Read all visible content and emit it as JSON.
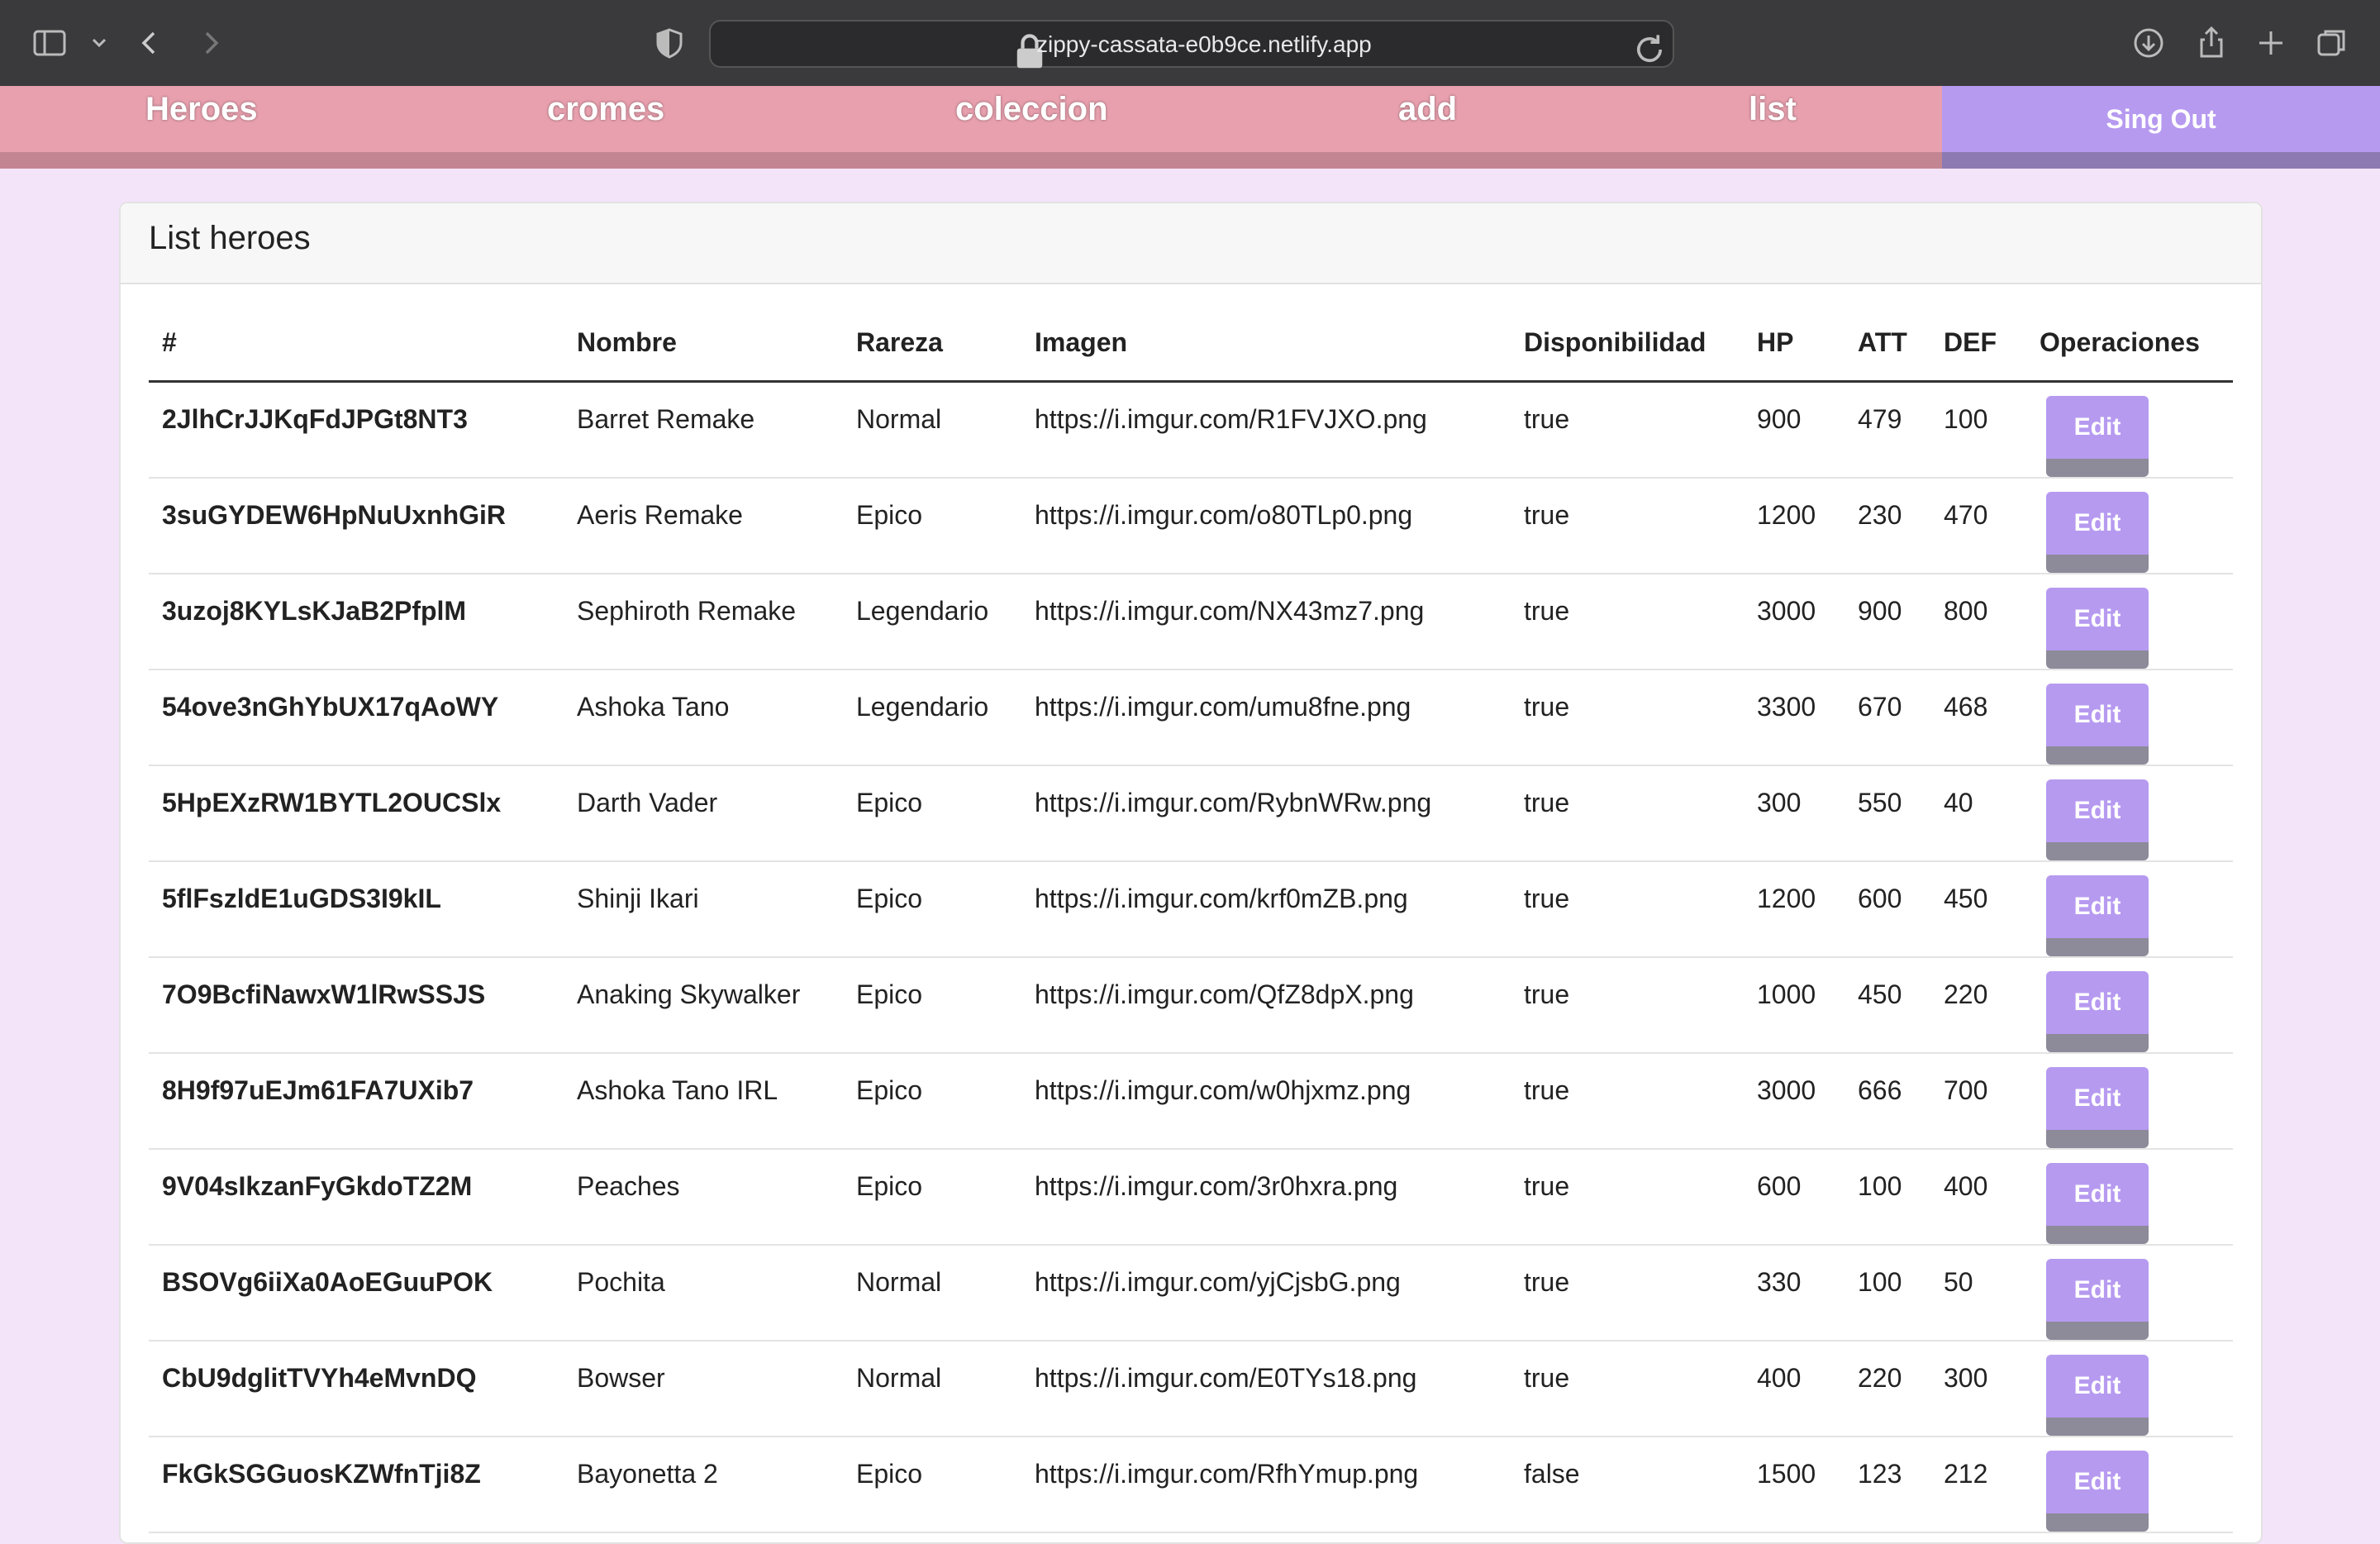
{
  "browser": {
    "url": "zippy-cassata-e0b9ce.netlify.app"
  },
  "nav": {
    "items": [
      "Heroes",
      "cromes",
      "coleccion",
      "add",
      "list"
    ],
    "signout": "Sing Out"
  },
  "card": {
    "title": "List heroes"
  },
  "table": {
    "headers": [
      "#",
      "Nombre",
      "Rareza",
      "Imagen",
      "Disponibilidad",
      "HP",
      "ATT",
      "DEF",
      "Operaciones"
    ],
    "edit_label": "Edit",
    "rows": [
      [
        "2JlhCrJJKqFdJPGt8NT3",
        "Barret Remake",
        "Normal",
        "https://i.imgur.com/R1FVJXO.png",
        "true",
        "900",
        "479",
        "100"
      ],
      [
        "3suGYDEW6HpNuUxnhGiR",
        "Aeris Remake",
        "Epico",
        "https://i.imgur.com/o80TLp0.png",
        "true",
        "1200",
        "230",
        "470"
      ],
      [
        "3uzoj8KYLsKJaB2PfplM",
        "Sephiroth Remake",
        "Legendario",
        "https://i.imgur.com/NX43mz7.png",
        "true",
        "3000",
        "900",
        "800"
      ],
      [
        "54ove3nGhYbUX17qAoWY",
        "Ashoka Tano",
        "Legendario",
        "https://i.imgur.com/umu8fne.png",
        "true",
        "3300",
        "670",
        "468"
      ],
      [
        "5HpEXzRW1BYTL2OUCSlx",
        "Darth Vader",
        "Epico",
        "https://i.imgur.com/RybnWRw.png",
        "true",
        "300",
        "550",
        "40"
      ],
      [
        "5flFszldE1uGDS3I9kIL",
        "Shinji Ikari",
        "Epico",
        "https://i.imgur.com/krf0mZB.png",
        "true",
        "1200",
        "600",
        "450"
      ],
      [
        "7O9BcfiNawxW1lRwSSJS",
        "Anaking Skywalker",
        "Epico",
        "https://i.imgur.com/QfZ8dpX.png",
        "true",
        "1000",
        "450",
        "220"
      ],
      [
        "8H9f97uEJm61FA7UXib7",
        "Ashoka Tano IRL",
        "Epico",
        "https://i.imgur.com/w0hjxmz.png",
        "true",
        "3000",
        "666",
        "700"
      ],
      [
        "9V04sIkzanFyGkdoTZ2M",
        "Peaches",
        "Epico",
        "https://i.imgur.com/3r0hxra.png",
        "true",
        "600",
        "100",
        "400"
      ],
      [
        "BSOVg6iiXa0AoEGuuPOK",
        "Pochita",
        "Normal",
        "https://i.imgur.com/yjCjsbG.png",
        "true",
        "330",
        "100",
        "50"
      ],
      [
        "CbU9dglitTVYh4eMvnDQ",
        "Bowser",
        "Normal",
        "https://i.imgur.com/E0TYs18.png",
        "true",
        "400",
        "220",
        "300"
      ],
      [
        "FkGkSGGuosKZWfnTji8Z",
        "Bayonetta 2",
        "Epico",
        "https://i.imgur.com/RfhYmup.png",
        "false",
        "1500",
        "123",
        "212"
      ]
    ]
  },
  "colors": {
    "page_bg": "#f4e4fa",
    "nav_bg": "#e8a0ae",
    "accent": "#b69af0",
    "chrome_bg": "#3a3a3c"
  },
  "icons": [
    "sidebar-icon",
    "chevron-down-icon",
    "back-icon",
    "forward-icon",
    "shield-icon",
    "lock-icon",
    "reload-icon",
    "download-icon",
    "share-icon",
    "new-tab-icon",
    "tabs-overview-icon"
  ]
}
